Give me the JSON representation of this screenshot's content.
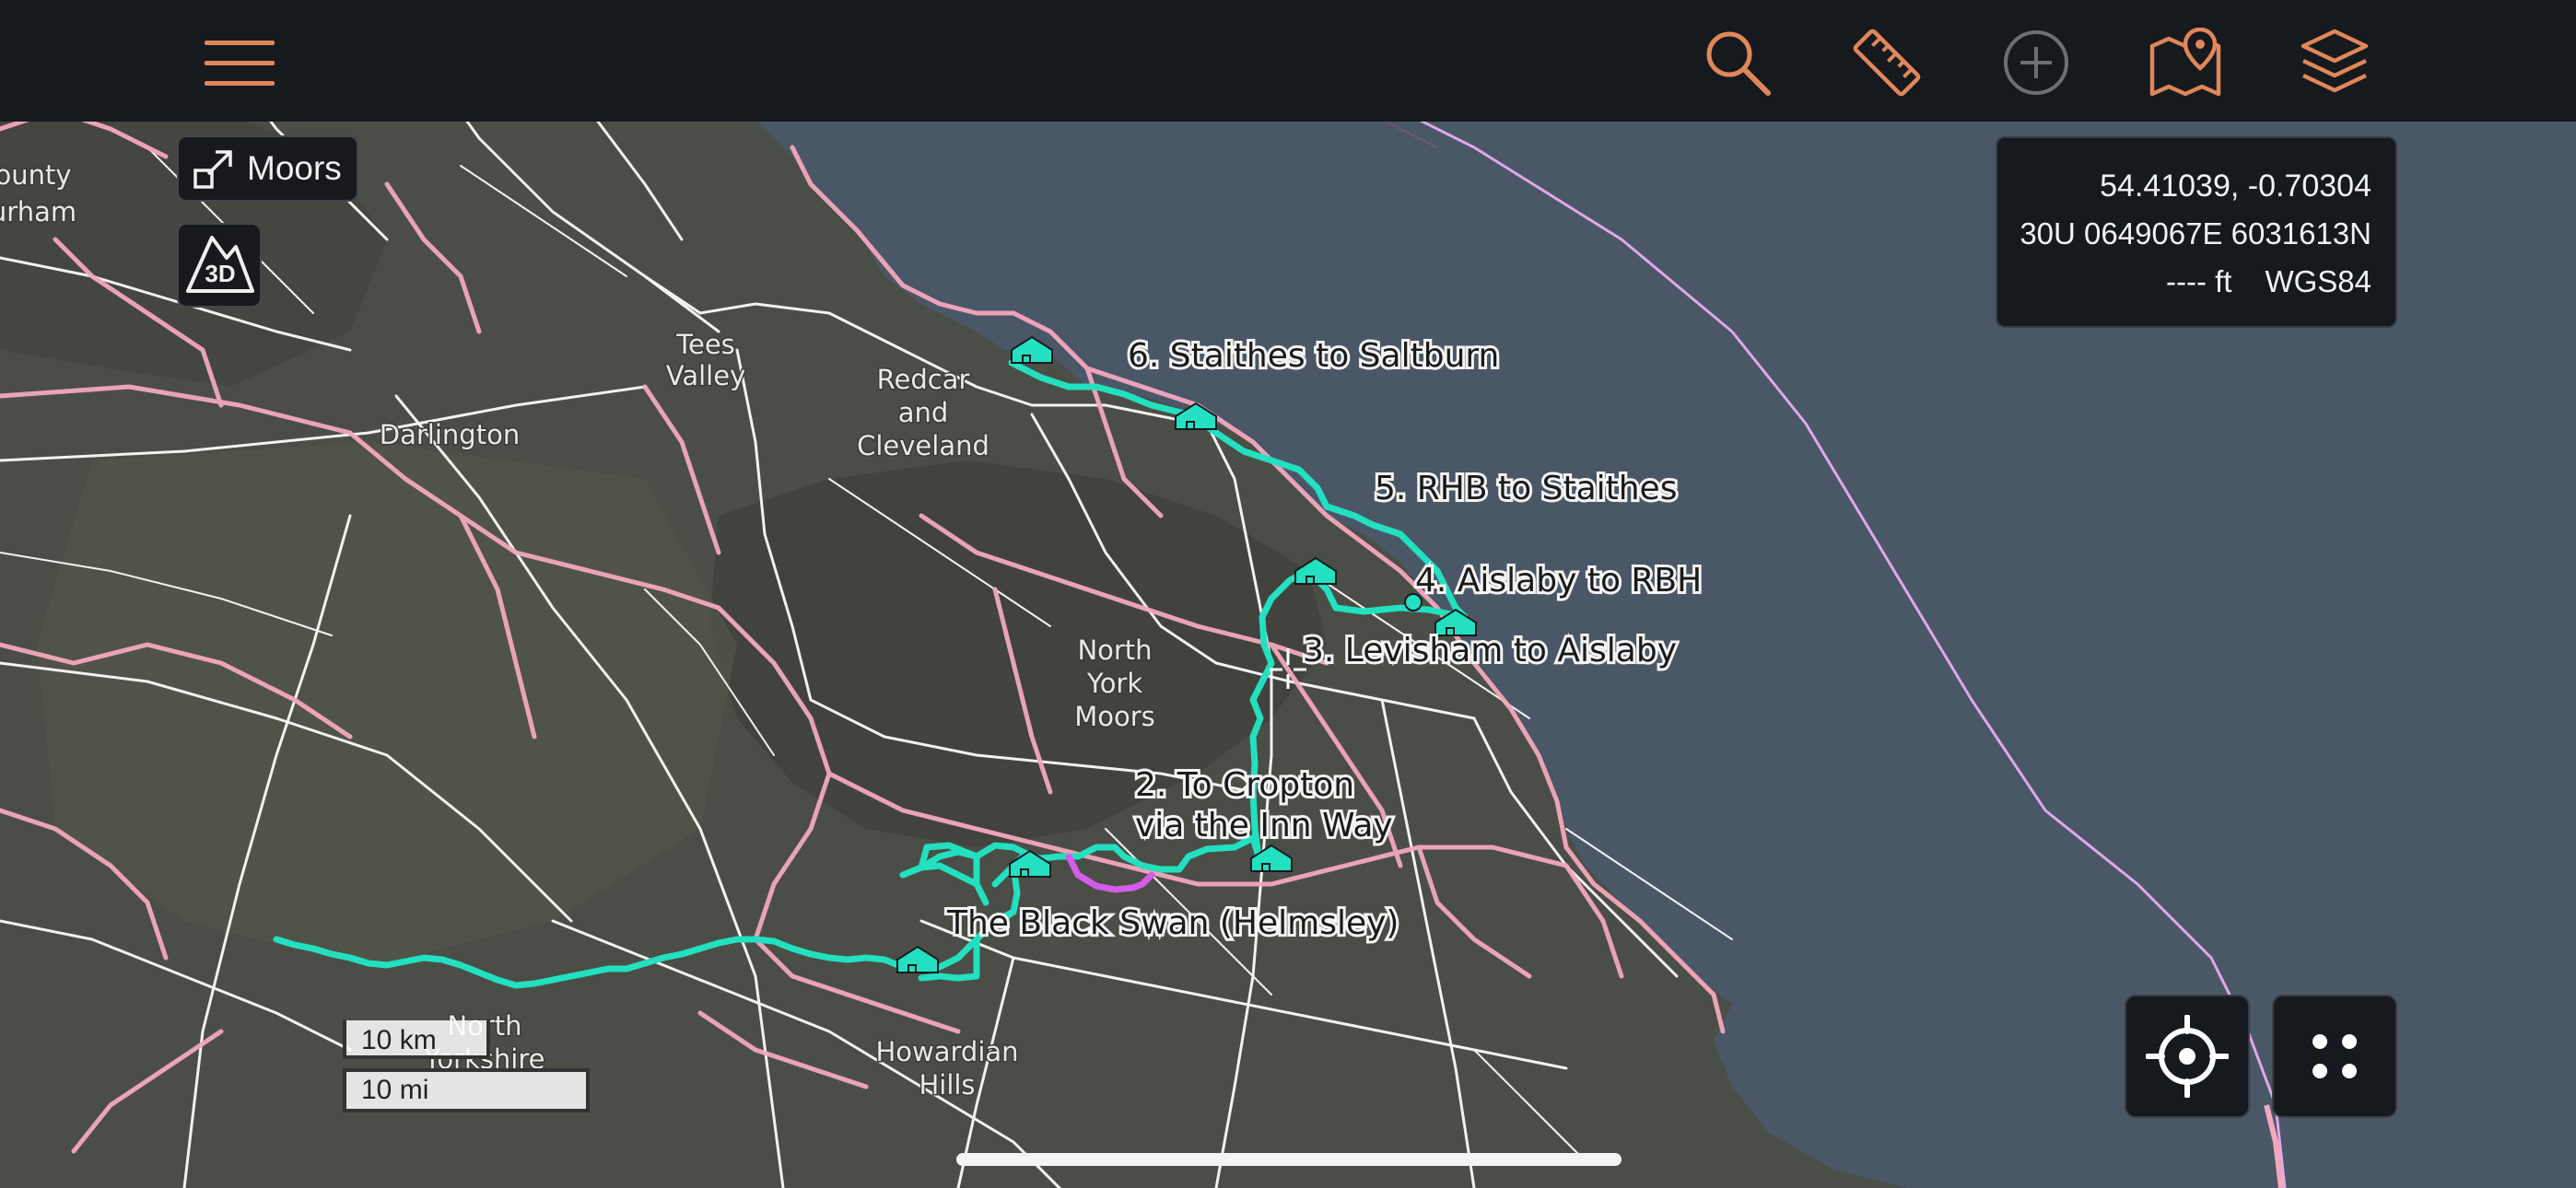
{
  "toolbar": {
    "menu_icon": "hamburger-menu-icon",
    "search_icon": "search-icon",
    "measure_icon": "ruler-icon",
    "add_icon": "add-circle-icon",
    "map_pin_icon": "map-pin-icon",
    "layers_icon": "layers-icon",
    "accent_color": "#e0875a",
    "disabled_color": "#6d6f72"
  },
  "map_chip": {
    "label": "Moors",
    "icon": "expand-arrow-icon"
  },
  "view_3d": {
    "label": "3D"
  },
  "coordinates": {
    "latlon": "54.41039, -0.70304",
    "utm": "30U 0649067E 6031613N",
    "elevation": "---- ft",
    "datum": "WGS84"
  },
  "place_labels": {
    "county": "ounty",
    "durham": "urham",
    "tees": "Tees",
    "valley": "Valley",
    "darlington": "Darlington",
    "redcar": "Redcar",
    "and": "and",
    "cleveland": "Cleveland",
    "north": "North",
    "york": "York",
    "moors": "Moors",
    "howardian": "Howardian",
    "hills": "Hills",
    "nyorks1": "North",
    "nyorks2": "Yorkshire"
  },
  "route_labels": {
    "stage6": "6. Staithes to Saltburn",
    "stage5": "5. RHB to Staithes",
    "stage4": "4. Aislaby to RBH",
    "stage3": "3. Levisham to Aislaby",
    "stage2_line1": "2. To Cropton",
    "stage2_line2": "via the Inn Way",
    "stage1": "The Black Swan (Helmsley)"
  },
  "colors": {
    "route": "#22e0c0",
    "route_alt": "#d45ce8",
    "boundary": "#f3a8bd",
    "road": "#ffffff",
    "sea": "#4a5766",
    "land": "#4b4d45"
  },
  "scale_bar": {
    "km_label": "10 km",
    "mi_label": "10 mi"
  },
  "controls": {
    "locate_icon": "crosshair-locate-icon",
    "more_icon": "four-dots-icon"
  }
}
